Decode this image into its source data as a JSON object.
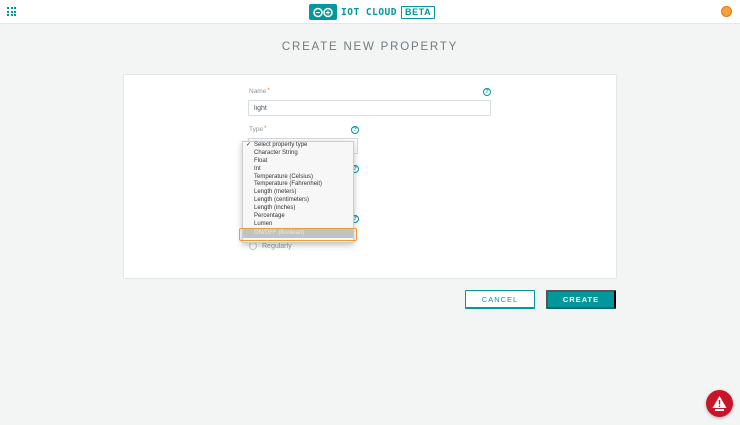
{
  "header": {
    "logo_text": "IOT CLOUD",
    "logo_badge": "BETA",
    "apps_icon": "apps-grid-icon",
    "avatar_color": "#f5a23a"
  },
  "page": {
    "title": "CREATE NEW PROPERTY"
  },
  "form": {
    "name": {
      "label": "Name",
      "required_mark": "*",
      "value": "light"
    },
    "type": {
      "label": "Type",
      "required_mark": "*",
      "options": [
        "Select property type",
        "Character String",
        "Float",
        "Int",
        "Temperature (Celsius)",
        "Temperature (Fahrenheit)",
        "Length (meters)",
        "Length (centimeters)",
        "Length (inches)",
        "Percentage",
        "Lumen",
        "ON/OFF (Boolean)"
      ],
      "selected_index": 0,
      "hovered_option": "ON/OFF (Boolean)"
    },
    "update": {
      "radio_label": "Regularly"
    },
    "help_glyph": "?"
  },
  "actions": {
    "cancel_label": "CANCEL",
    "create_label": "CREATE"
  },
  "colors": {
    "accent": "#00979d",
    "highlight": "#f09a32",
    "alert": "#c8152a"
  }
}
